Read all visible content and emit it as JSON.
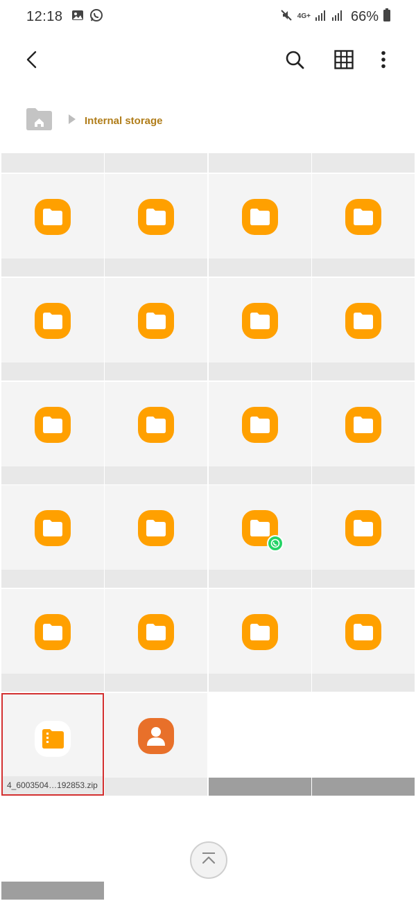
{
  "status_bar": {
    "time": "12:18",
    "network_type": "4G+",
    "battery_percent": "66%",
    "left_icons": [
      "gallery-icon",
      "whatsapp-icon"
    ],
    "right_icons": [
      "mute-icon",
      "signal-icon",
      "signal-icon",
      "battery-icon"
    ]
  },
  "toolbar": {
    "back_icon": "back-arrow-icon",
    "search_icon": "search-icon",
    "view_icon": "grid-view-icon",
    "more_icon": "more-vert-icon"
  },
  "breadcrumb": {
    "home_icon": "home-folder-icon",
    "current": "Internal storage"
  },
  "files": {
    "folder_count": 20,
    "selected_file_name": "4_6003504…192853.zip",
    "contact_item": "contact-icon",
    "whatsapp_folder_index": 14
  },
  "colors": {
    "folder": "#ffa000",
    "accent_text": "#b07d1a",
    "selection_border": "#d32f2f",
    "contact": "#e8702a",
    "whatsapp": "#25d366"
  },
  "scroll_top_icon": "scroll-to-top-icon"
}
